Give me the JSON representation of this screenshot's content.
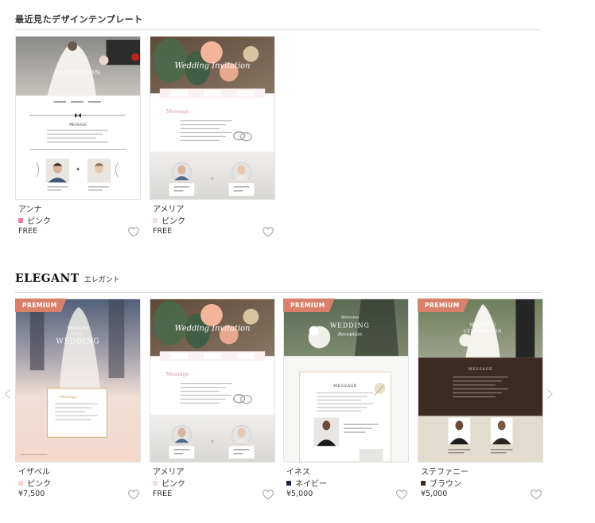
{
  "recent": {
    "title": "最近見たデザインテンプレート",
    "cards": [
      {
        "name": "アンナ",
        "color_label": "ピンク",
        "swatch": "#f07ba6",
        "price": "FREE",
        "premium": false,
        "thumb_kind": "anna",
        "thumb_text": {
          "hero": "INVITATION",
          "message": "MESSAGE"
        }
      },
      {
        "name": "アメリア",
        "color_label": "ピンク",
        "swatch": "#f3dde3",
        "price": "FREE",
        "premium": false,
        "thumb_kind": "amelia",
        "thumb_text": {
          "hero": "Wedding Invitation",
          "message": "Message"
        }
      }
    ]
  },
  "elegant": {
    "title_en": "ELEGANT",
    "title_jp": "エレガント",
    "badge_label": "PREMIUM",
    "cards": [
      {
        "name": "イザベル",
        "color_label": "ピンク",
        "swatch": "#f2d6c8",
        "price": "¥7,500",
        "premium": true,
        "thumb_kind": "isabelle",
        "thumb_text": {
          "hero": "Welcome to our WEDDING",
          "message": "Message"
        }
      },
      {
        "name": "アメリア",
        "color_label": "ピンク",
        "swatch": "#f3dde3",
        "price": "FREE",
        "premium": false,
        "thumb_kind": "amelia",
        "thumb_text": {
          "hero": "Wedding Invitation",
          "message": "Message"
        }
      },
      {
        "name": "イネス",
        "color_label": "ネイビー",
        "swatch": "#1c2540",
        "price": "¥5,000",
        "premium": true,
        "thumb_kind": "ines",
        "thumb_text": {
          "hero": "WEDDING Reception",
          "message": "MESSAGE"
        }
      },
      {
        "name": "ステファニー",
        "color_label": "ブラウン",
        "swatch": "#3b2a22",
        "price": "¥5,000",
        "premium": true,
        "thumb_kind": "stephanie",
        "thumb_text": {
          "hero": "WEDDING CELEBRATION",
          "message": "MESSAGE"
        }
      }
    ]
  },
  "icons": {
    "favorite": "heart-outline-icon",
    "prev": "chevron-left-icon",
    "next": "chevron-right-icon"
  }
}
